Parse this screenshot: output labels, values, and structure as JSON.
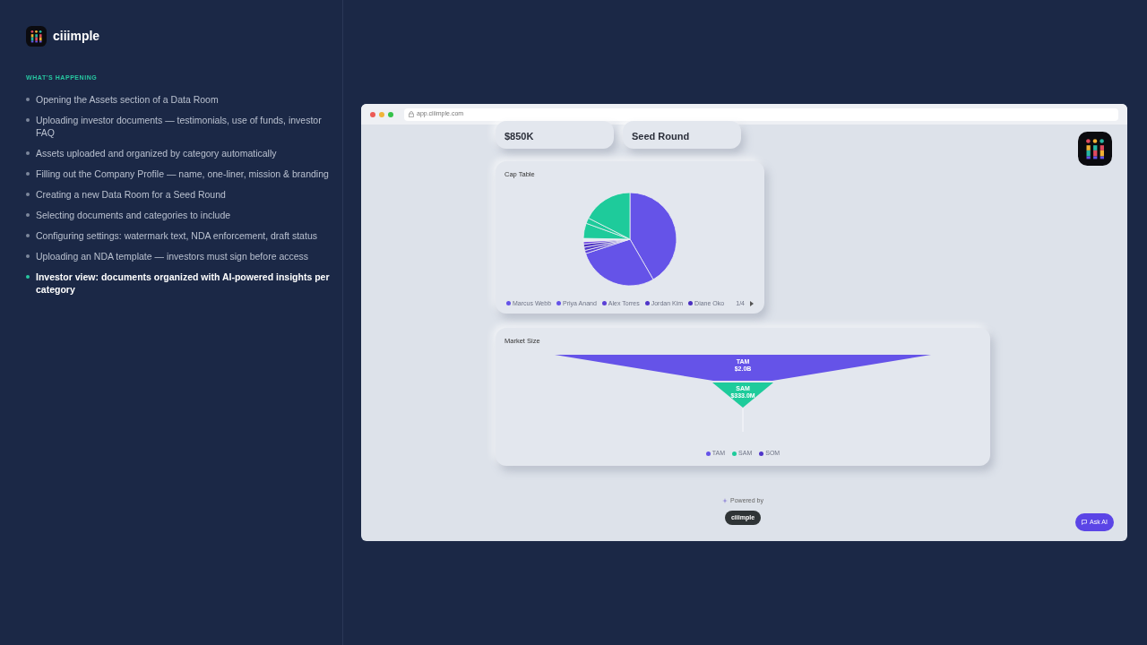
{
  "brand": {
    "name": "ciiimple"
  },
  "sidebar": {
    "heading": "WHAT'S HAPPENING",
    "steps": [
      {
        "text": "Opening the Assets section of a Data Room",
        "selected": false
      },
      {
        "text": "Uploading investor documents — testimonials, use of funds, investor FAQ",
        "selected": false
      },
      {
        "text": "Assets uploaded and organized by category automatically",
        "selected": false
      },
      {
        "text": "Filling out the Company Profile — name, one-liner, mission & branding",
        "selected": false
      },
      {
        "text": "Creating a new Data Room for a Seed Round",
        "selected": false
      },
      {
        "text": "Selecting documents and categories to include",
        "selected": false
      },
      {
        "text": "Configuring settings: watermark text, NDA enforcement, draft status",
        "selected": false
      },
      {
        "text": "Uploading an NDA template — investors must sign before access",
        "selected": false
      },
      {
        "text": "Investor view: documents organized with AI-powered insights per category",
        "selected": true
      }
    ]
  },
  "browser": {
    "url": "app.ciiimple.com"
  },
  "stat_cards": [
    "$850K",
    "Seed Round"
  ],
  "cap_table": {
    "title": "Cap Table",
    "legend": [
      {
        "label": "Marcus Webb",
        "color": "#6553e8"
      },
      {
        "label": "Priya Anand",
        "color": "#6553e8"
      },
      {
        "label": "Alex Torres",
        "color": "#5a3fd6"
      },
      {
        "label": "Jordan Kim",
        "color": "#4f35c9"
      },
      {
        "label": "Diane Oko",
        "color": "#4a2fc0"
      }
    ],
    "page": "1/4"
  },
  "market_size": {
    "title": "Market Size",
    "tiers": [
      {
        "label": "TAM",
        "value": "$2.0B",
        "color": "#6553e8"
      },
      {
        "label": "SAM",
        "value": "$333.0M",
        "color": "#1ecb9b"
      }
    ],
    "legend": [
      {
        "label": "TAM",
        "color": "#6553e8"
      },
      {
        "label": "SAM",
        "color": "#1ecb9b"
      },
      {
        "label": "SOM",
        "color": "#4f35c9"
      }
    ]
  },
  "footer": {
    "powered_by": "Powered by",
    "brand": "ciiimple"
  },
  "ask_ai": "Ask AI"
}
